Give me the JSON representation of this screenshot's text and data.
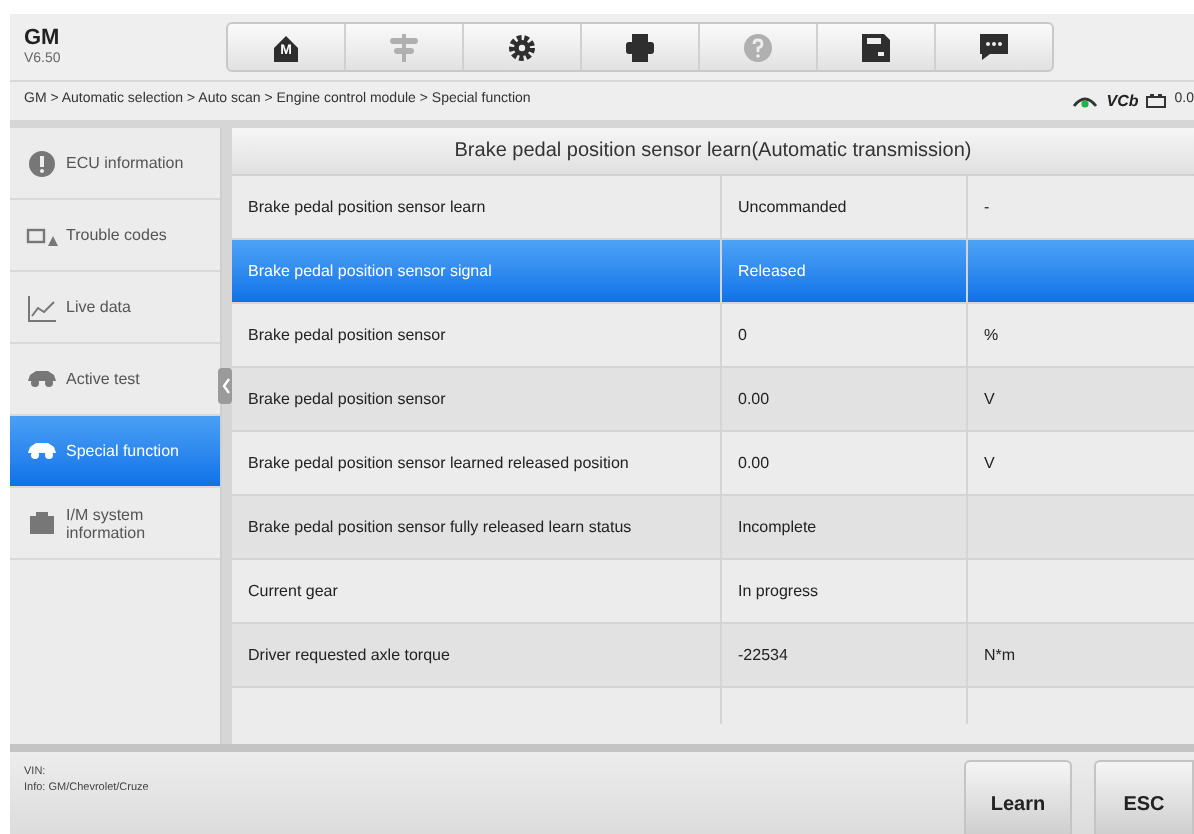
{
  "app": {
    "title": "GM",
    "version": "V6.50"
  },
  "toolbar": [
    {
      "kind": "home",
      "label": "M",
      "disabled": false
    },
    {
      "kind": "vehicle",
      "disabled": true
    },
    {
      "kind": "settings",
      "disabled": false
    },
    {
      "kind": "print",
      "disabled": false
    },
    {
      "kind": "help",
      "disabled": true
    },
    {
      "kind": "save",
      "disabled": false
    },
    {
      "kind": "message",
      "disabled": false
    }
  ],
  "breadcrumb": "GM > Automatic selection > Auto scan > Engine control module > Special function",
  "status": {
    "vci_label": "VCb",
    "voltage": "0.0"
  },
  "sidebar": [
    {
      "kind": "info",
      "label": "ECU information",
      "selected": false
    },
    {
      "kind": "codes",
      "label": "Trouble codes",
      "selected": false
    },
    {
      "kind": "live",
      "label": "Live data",
      "selected": false
    },
    {
      "kind": "active",
      "label": "Active test",
      "selected": false
    },
    {
      "kind": "special",
      "label": "Special function",
      "selected": true
    },
    {
      "kind": "im",
      "label": "I/M system information",
      "selected": false
    }
  ],
  "table": {
    "title": "Brake pedal position sensor learn(Automatic transmission)",
    "rows": [
      {
        "name": "Brake pedal position sensor learn",
        "value": "Uncommanded",
        "unit": "-",
        "selected": false
      },
      {
        "name": "Brake pedal position sensor signal",
        "value": "Released",
        "selected": true
      },
      {
        "name": "Brake pedal position sensor",
        "value": "0",
        "unit": "%",
        "selected": false
      },
      {
        "name": "Brake pedal position sensor",
        "value": "0.00",
        "unit": "V",
        "selected": false
      },
      {
        "name": "Brake pedal position sensor learned released position",
        "value": "0.00",
        "unit": "V",
        "selected": false
      },
      {
        "name": "Brake pedal position sensor fully released learn status",
        "value": "Incomplete",
        "selected": false
      },
      {
        "name": "Current gear",
        "value": "In progress",
        "selected": false
      },
      {
        "name": "Driver requested axle torque",
        "value": "-22534",
        "unit": "N*m",
        "selected": false
      }
    ]
  },
  "footer": {
    "vin": "VIN:",
    "info": "Info: GM/Chevrolet/Cruze",
    "buttons": [
      "Learn",
      "ESC"
    ]
  }
}
